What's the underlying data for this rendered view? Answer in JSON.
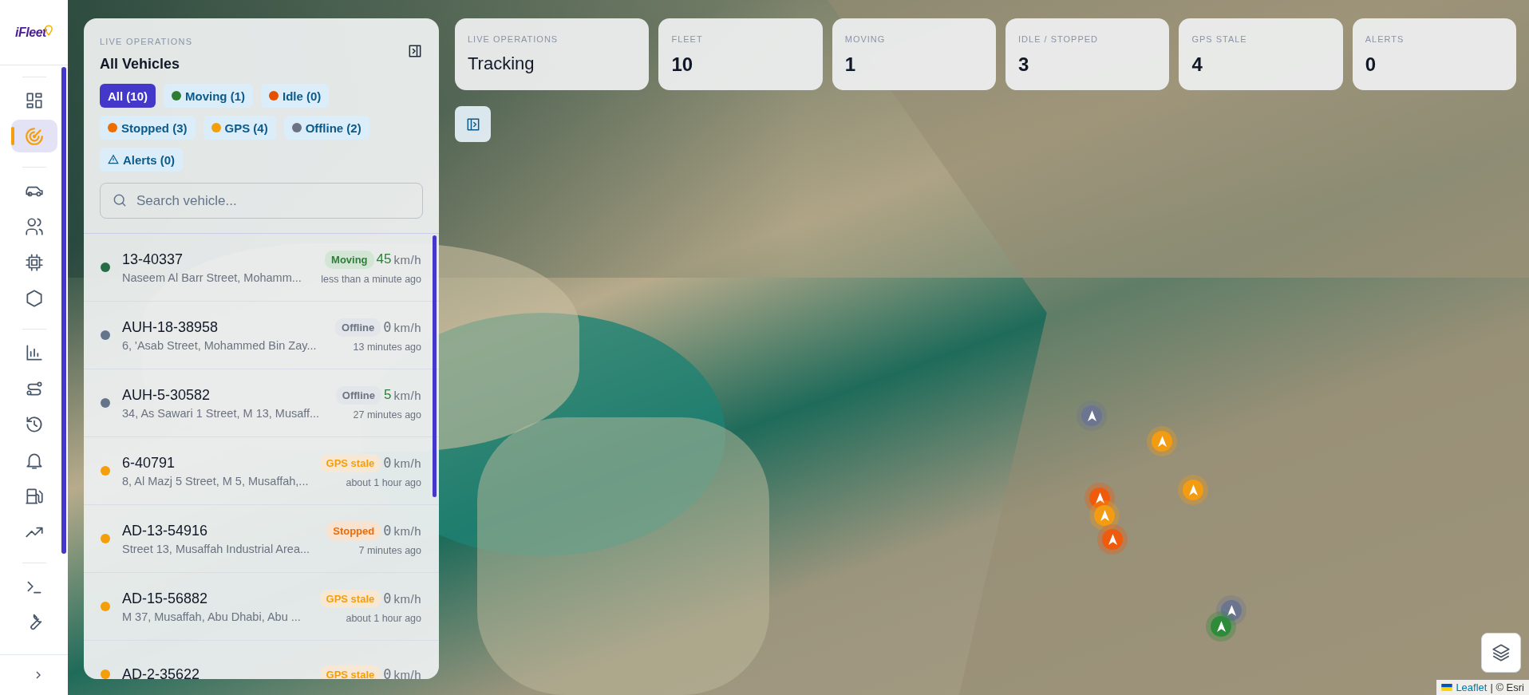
{
  "logo": {
    "text": "iFleet"
  },
  "nav": {
    "groups": [
      [
        {
          "selected": false
        },
        {
          "selected": true
        }
      ],
      [
        {
          "selected": false
        },
        {
          "selected": false
        },
        {
          "selected": false
        },
        {
          "selected": false
        }
      ],
      [
        {
          "selected": false
        },
        {
          "selected": false
        },
        {
          "selected": false
        },
        {
          "selected": false
        },
        {
          "selected": false
        },
        {
          "selected": false
        }
      ],
      [
        {
          "selected": false
        },
        {
          "selected": false
        }
      ]
    ]
  },
  "panel": {
    "eyebrow": "LIVE OPERATIONS",
    "title": "All Vehicles",
    "filters": [
      {
        "kind": "all",
        "label": "All (10)",
        "selected": true
      },
      {
        "kind": "status",
        "label": "Moving (1)",
        "color": "#2e7d32",
        "selected": false
      },
      {
        "kind": "status",
        "label": "Idle (0)",
        "color": "#e65100",
        "selected": false
      },
      {
        "kind": "status",
        "label": "Stopped (3)",
        "color": "#ef6c00",
        "selected": false
      },
      {
        "kind": "status",
        "label": "GPS (4)",
        "color": "#f59e0b",
        "selected": false
      },
      {
        "kind": "status",
        "label": "Offline (2)",
        "color": "#6b7280",
        "selected": false
      },
      {
        "kind": "alerts",
        "label": "Alerts (0)",
        "selected": false
      }
    ],
    "search": {
      "placeholder": "Search vehicle..."
    },
    "vehicles": [
      {
        "name": "13-40337",
        "address": "Naseem Al Barr Street, Mohamm...",
        "status": "Moving",
        "kind": "moving",
        "color": "#256d45",
        "speed": "45",
        "speed_active": true,
        "unit": "km/h",
        "time": "less than a minute ago"
      },
      {
        "name": "AUH-18-38958",
        "address": "6, 'Asab Street, Mohammed Bin Zay...",
        "status": "Offline",
        "kind": "offline",
        "color": "#64748b",
        "speed": "0",
        "speed_active": false,
        "unit": "km/h",
        "time": "13 minutes ago"
      },
      {
        "name": "AUH-5-30582",
        "address": "34, As Sawari 1 Street, M 13, Musaff...",
        "status": "Offline",
        "kind": "offline",
        "color": "#64748b",
        "speed": "5",
        "speed_active": true,
        "unit": "km/h",
        "time": "27 minutes ago"
      },
      {
        "name": "6-40791",
        "address": "8, Al Mazj 5 Street, M 5, Musaffah,...",
        "status": "GPS stale",
        "kind": "gps",
        "color": "#f59e0b",
        "speed": "0",
        "speed_active": false,
        "unit": "km/h",
        "time": "about 1 hour ago"
      },
      {
        "name": "AD-13-54916",
        "address": "Street 13, Musaffah Industrial Area...",
        "status": "Stopped",
        "kind": "stopped",
        "color": "#f59e0b",
        "speed": "0",
        "speed_active": false,
        "unit": "km/h",
        "time": "7 minutes ago"
      },
      {
        "name": "AD-15-56882",
        "address": "M 37, Musaffah, Abu Dhabi, Abu ...",
        "status": "GPS stale",
        "kind": "gps",
        "color": "#f59e0b",
        "speed": "0",
        "speed_active": false,
        "unit": "km/h",
        "time": "about 1 hour ago"
      },
      {
        "name": "AD-2-35622",
        "status": "GPS stale",
        "kind": "gps",
        "color": "#f59e0b",
        "speed": "0",
        "speed_active": false,
        "unit": "km/h"
      }
    ]
  },
  "stats": [
    {
      "label": "LIVE OPERATIONS",
      "value": "Tracking",
      "kind": "text"
    },
    {
      "label": "FLEET",
      "value": "10",
      "kind": "number"
    },
    {
      "label": "MOVING",
      "value": "1",
      "kind": "number"
    },
    {
      "label": "IDLE / STOPPED",
      "value": "3",
      "kind": "number"
    },
    {
      "label": "GPS STALE",
      "value": "4",
      "kind": "number"
    },
    {
      "label": "ALERTS",
      "value": "0",
      "kind": "number"
    }
  ],
  "markers": [
    {
      "color": "#6b7590"
    },
    {
      "color": "#f39c12"
    },
    {
      "color": "#f39c12"
    },
    {
      "color": "#ef5b0c"
    },
    {
      "color": "#f39c12"
    },
    {
      "color": "#ef5b0c"
    },
    {
      "color": "#6b7590"
    },
    {
      "color": "#2e8b3a"
    }
  ],
  "attribution": {
    "link": "Leaflet",
    "text": "| © Esri"
  }
}
